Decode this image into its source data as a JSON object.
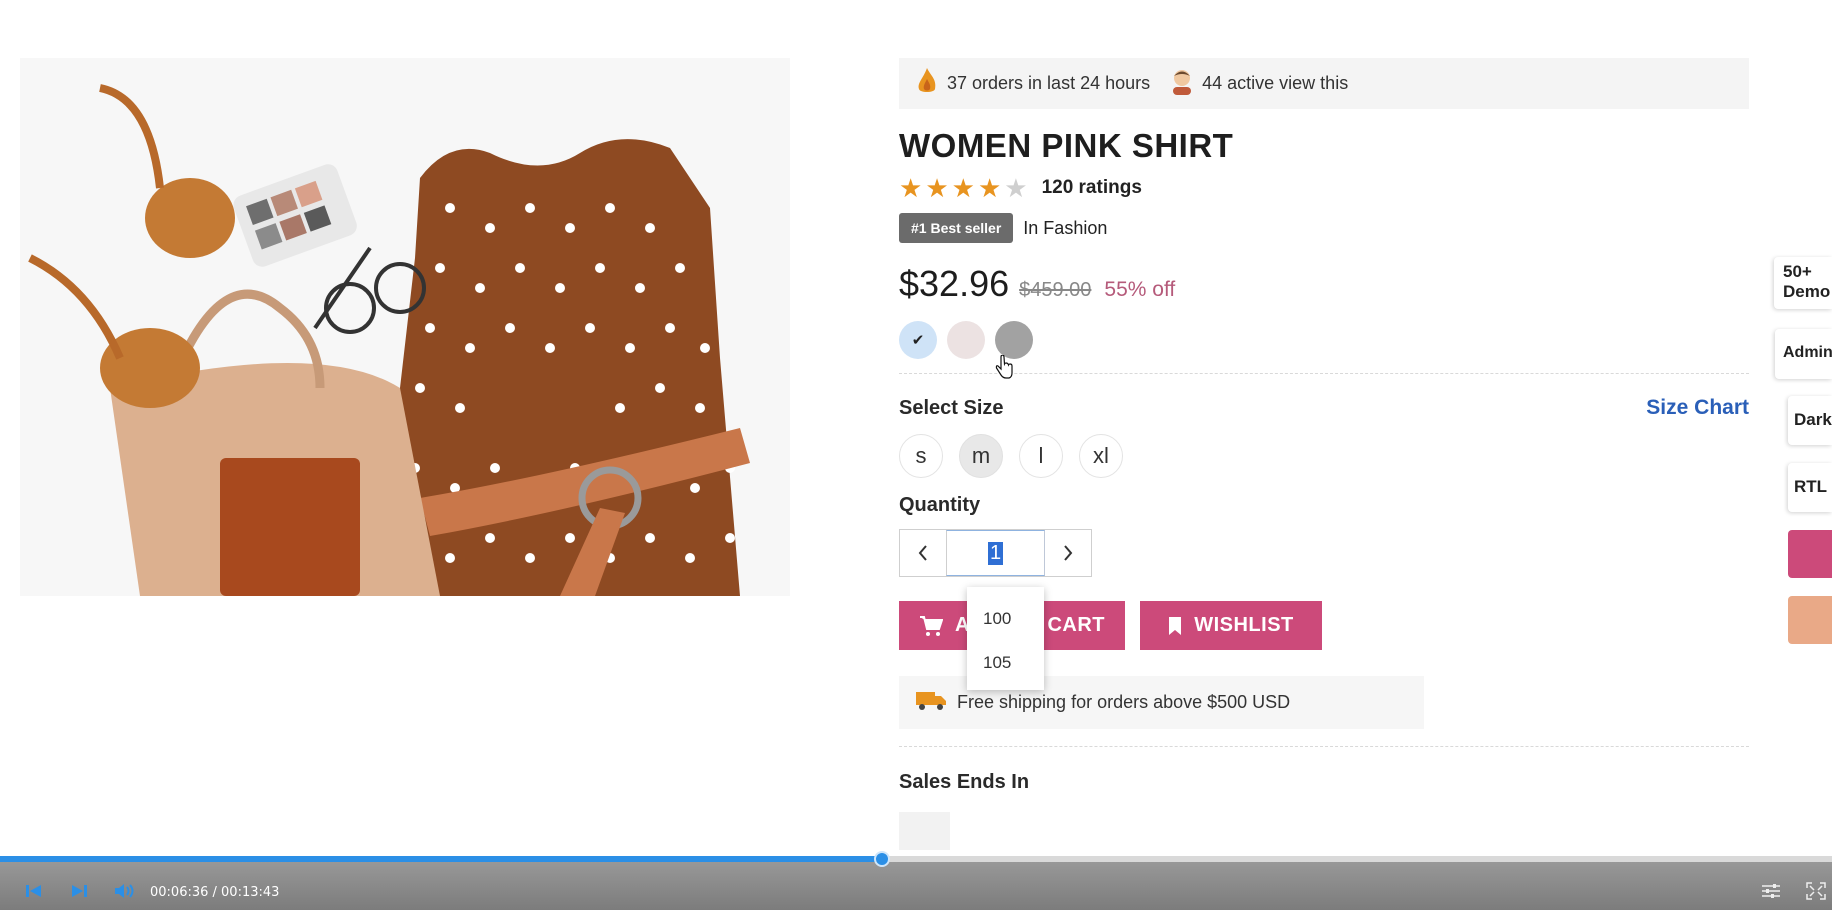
{
  "urgency": {
    "orders_text": "37 orders in last 24 hours",
    "viewers_text": "44 active view this"
  },
  "product": {
    "title": "WOMEN PINK SHIRT",
    "rating": 4,
    "rating_max": 5,
    "ratings_text": "120 ratings",
    "badge": "#1 Best seller",
    "category": "In Fashion",
    "price": "$32.96",
    "old_price": "$459.00",
    "discount": "55% off",
    "colors": [
      {
        "name": "light-blue",
        "hex": "#cfe3f7",
        "selected": true
      },
      {
        "name": "light-pink",
        "hex": "#ece2e2",
        "selected": false
      },
      {
        "name": "grey",
        "hex": "#a2a2a2",
        "selected": false
      }
    ]
  },
  "size": {
    "label": "Select Size",
    "chart_link": "Size Chart",
    "options": [
      "s",
      "m",
      "l",
      "xl"
    ],
    "selected": "m"
  },
  "quantity": {
    "label": "Quantity",
    "value": "1",
    "dec_icon": "chevron-left-icon",
    "inc_icon": "chevron-right-icon",
    "suggestions": [
      "100",
      "105"
    ]
  },
  "buttons": {
    "cart_label": "ADD TO CART",
    "cart_visible_prefix": "A",
    "cart_visible_suffix": "CART",
    "wishlist_label": "WISHLIST"
  },
  "shipping": {
    "text": "Free shipping for orders above $500 USD"
  },
  "sales": {
    "label": "Sales Ends In"
  },
  "side_tabs": {
    "demos": "50+ Demo",
    "admin": "Admin",
    "dark": "Dark",
    "rtl": "RTL"
  },
  "player": {
    "current_time": "00:06:36",
    "total_time": "00:13:43",
    "time_text": "00:06:36 / 00:13:43",
    "progress": 0.4813
  },
  "colors": {
    "accent": "#cc4a7a",
    "link": "#2a5fb8",
    "star": "#e89420",
    "progress": "#2b8fe6"
  }
}
